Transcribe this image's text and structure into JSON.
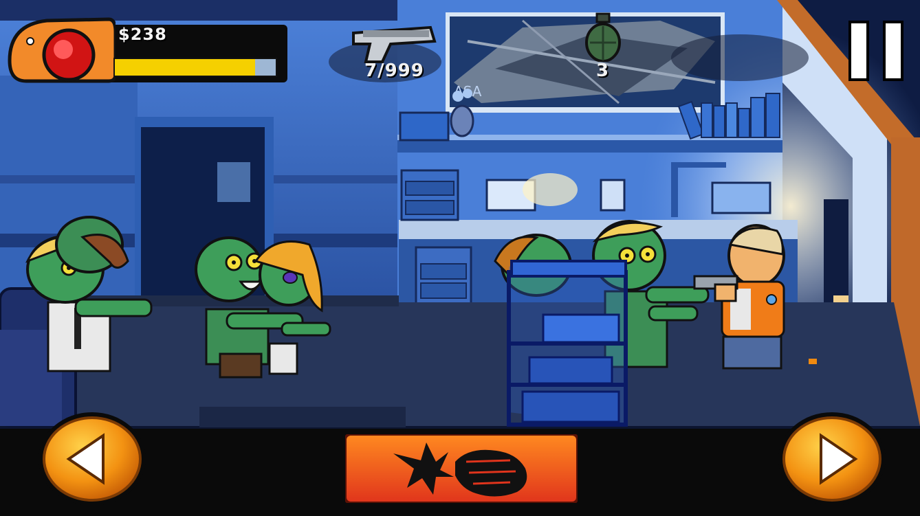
{
  "hud": {
    "money": "$238",
    "health_level": 0.87,
    "ammo": "7/999",
    "grenades": "3",
    "poster_text": "ASA"
  },
  "controls": {
    "move_left": "move-left-icon",
    "attack": "punch-fist-icon",
    "move_right": "move-right-icon",
    "pause": "pause-icon"
  },
  "colors": {
    "health_fill": "#f5d000",
    "button_orange": "#f08a10",
    "attack_red": "#e2431f",
    "zombie_green": "#3e9e5a",
    "wall_blue": "#3f6fc4"
  }
}
